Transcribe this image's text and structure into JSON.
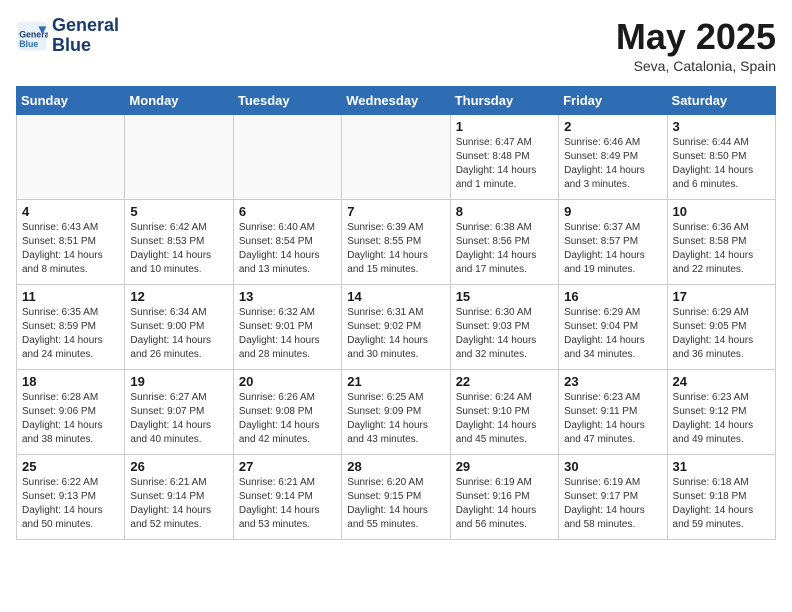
{
  "header": {
    "logo_line1": "General",
    "logo_line2": "Blue",
    "month_title": "May 2025",
    "location": "Seva, Catalonia, Spain"
  },
  "days_of_week": [
    "Sunday",
    "Monday",
    "Tuesday",
    "Wednesday",
    "Thursday",
    "Friday",
    "Saturday"
  ],
  "weeks": [
    [
      {
        "day": "",
        "info": ""
      },
      {
        "day": "",
        "info": ""
      },
      {
        "day": "",
        "info": ""
      },
      {
        "day": "",
        "info": ""
      },
      {
        "day": "1",
        "info": "Sunrise: 6:47 AM\nSunset: 8:48 PM\nDaylight: 14 hours and 1 minute."
      },
      {
        "day": "2",
        "info": "Sunrise: 6:46 AM\nSunset: 8:49 PM\nDaylight: 14 hours and 3 minutes."
      },
      {
        "day": "3",
        "info": "Sunrise: 6:44 AM\nSunset: 8:50 PM\nDaylight: 14 hours and 6 minutes."
      }
    ],
    [
      {
        "day": "4",
        "info": "Sunrise: 6:43 AM\nSunset: 8:51 PM\nDaylight: 14 hours and 8 minutes."
      },
      {
        "day": "5",
        "info": "Sunrise: 6:42 AM\nSunset: 8:53 PM\nDaylight: 14 hours and 10 minutes."
      },
      {
        "day": "6",
        "info": "Sunrise: 6:40 AM\nSunset: 8:54 PM\nDaylight: 14 hours and 13 minutes."
      },
      {
        "day": "7",
        "info": "Sunrise: 6:39 AM\nSunset: 8:55 PM\nDaylight: 14 hours and 15 minutes."
      },
      {
        "day": "8",
        "info": "Sunrise: 6:38 AM\nSunset: 8:56 PM\nDaylight: 14 hours and 17 minutes."
      },
      {
        "day": "9",
        "info": "Sunrise: 6:37 AM\nSunset: 8:57 PM\nDaylight: 14 hours and 19 minutes."
      },
      {
        "day": "10",
        "info": "Sunrise: 6:36 AM\nSunset: 8:58 PM\nDaylight: 14 hours and 22 minutes."
      }
    ],
    [
      {
        "day": "11",
        "info": "Sunrise: 6:35 AM\nSunset: 8:59 PM\nDaylight: 14 hours and 24 minutes."
      },
      {
        "day": "12",
        "info": "Sunrise: 6:34 AM\nSunset: 9:00 PM\nDaylight: 14 hours and 26 minutes."
      },
      {
        "day": "13",
        "info": "Sunrise: 6:32 AM\nSunset: 9:01 PM\nDaylight: 14 hours and 28 minutes."
      },
      {
        "day": "14",
        "info": "Sunrise: 6:31 AM\nSunset: 9:02 PM\nDaylight: 14 hours and 30 minutes."
      },
      {
        "day": "15",
        "info": "Sunrise: 6:30 AM\nSunset: 9:03 PM\nDaylight: 14 hours and 32 minutes."
      },
      {
        "day": "16",
        "info": "Sunrise: 6:29 AM\nSunset: 9:04 PM\nDaylight: 14 hours and 34 minutes."
      },
      {
        "day": "17",
        "info": "Sunrise: 6:29 AM\nSunset: 9:05 PM\nDaylight: 14 hours and 36 minutes."
      }
    ],
    [
      {
        "day": "18",
        "info": "Sunrise: 6:28 AM\nSunset: 9:06 PM\nDaylight: 14 hours and 38 minutes."
      },
      {
        "day": "19",
        "info": "Sunrise: 6:27 AM\nSunset: 9:07 PM\nDaylight: 14 hours and 40 minutes."
      },
      {
        "day": "20",
        "info": "Sunrise: 6:26 AM\nSunset: 9:08 PM\nDaylight: 14 hours and 42 minutes."
      },
      {
        "day": "21",
        "info": "Sunrise: 6:25 AM\nSunset: 9:09 PM\nDaylight: 14 hours and 43 minutes."
      },
      {
        "day": "22",
        "info": "Sunrise: 6:24 AM\nSunset: 9:10 PM\nDaylight: 14 hours and 45 minutes."
      },
      {
        "day": "23",
        "info": "Sunrise: 6:23 AM\nSunset: 9:11 PM\nDaylight: 14 hours and 47 minutes."
      },
      {
        "day": "24",
        "info": "Sunrise: 6:23 AM\nSunset: 9:12 PM\nDaylight: 14 hours and 49 minutes."
      }
    ],
    [
      {
        "day": "25",
        "info": "Sunrise: 6:22 AM\nSunset: 9:13 PM\nDaylight: 14 hours and 50 minutes."
      },
      {
        "day": "26",
        "info": "Sunrise: 6:21 AM\nSunset: 9:14 PM\nDaylight: 14 hours and 52 minutes."
      },
      {
        "day": "27",
        "info": "Sunrise: 6:21 AM\nSunset: 9:14 PM\nDaylight: 14 hours and 53 minutes."
      },
      {
        "day": "28",
        "info": "Sunrise: 6:20 AM\nSunset: 9:15 PM\nDaylight: 14 hours and 55 minutes."
      },
      {
        "day": "29",
        "info": "Sunrise: 6:19 AM\nSunset: 9:16 PM\nDaylight: 14 hours and 56 minutes."
      },
      {
        "day": "30",
        "info": "Sunrise: 6:19 AM\nSunset: 9:17 PM\nDaylight: 14 hours and 58 minutes."
      },
      {
        "day": "31",
        "info": "Sunrise: 6:18 AM\nSunset: 9:18 PM\nDaylight: 14 hours and 59 minutes."
      }
    ]
  ]
}
